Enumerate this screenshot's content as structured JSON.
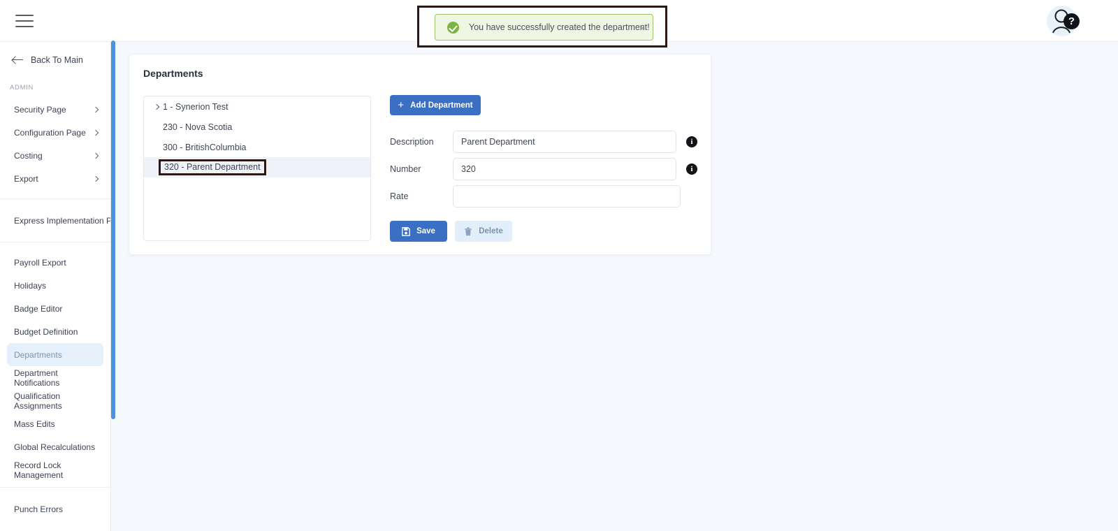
{
  "topbar": {
    "menu_icon": "hamburger-icon",
    "avatar_icon": "user-avatar-icon",
    "help_badge": "?"
  },
  "toast": {
    "message": "You have successfully created the department!",
    "status_icon": "success-check-icon",
    "close_label": "×",
    "bg_color": "#f0f6e4",
    "border_color": "#9cc46a",
    "icon_color": "#7cb342"
  },
  "sidebar": {
    "back_label": "Back To Main",
    "section_label": "ADMIN",
    "expandable": [
      {
        "label": "Security Page"
      },
      {
        "label": "Configuration Page"
      },
      {
        "label": "Costing"
      },
      {
        "label": "Export"
      }
    ],
    "standalone": [
      {
        "label": "Express Implementation P..."
      }
    ],
    "items": [
      {
        "label": "Payroll Export",
        "active": false
      },
      {
        "label": "Holidays",
        "active": false
      },
      {
        "label": "Badge Editor",
        "active": false
      },
      {
        "label": "Budget Definition",
        "active": false
      },
      {
        "label": "Departments",
        "active": true
      },
      {
        "label": "Department Notifications",
        "active": false
      },
      {
        "label": "Qualification Assignments",
        "active": false
      },
      {
        "label": "Mass Edits",
        "active": false
      },
      {
        "label": "Global Recalculations",
        "active": false
      },
      {
        "label": "Record Lock Management",
        "active": false
      }
    ],
    "footer_items": [
      {
        "label": "Punch Errors"
      }
    ],
    "active_color": "#e5f0fb",
    "scrollbar_color": "#4d93dd"
  },
  "card": {
    "title": "Departments",
    "tree": [
      {
        "label": "1 - Synerion Test",
        "expandable": true,
        "selected": false
      },
      {
        "label": "230 - Nova Scotia",
        "expandable": false,
        "selected": false
      },
      {
        "label": "300 - BritishColumbia",
        "expandable": false,
        "selected": false
      },
      {
        "label": "320 - Parent Department",
        "expandable": false,
        "selected": true
      }
    ],
    "add_button": {
      "label": "Add Department",
      "plus": "+",
      "color": "#3b6fc4"
    },
    "fields": [
      {
        "label": "Description",
        "value": "Parent Department",
        "info": true
      },
      {
        "label": "Number",
        "value": "320",
        "info": true
      },
      {
        "label": "Rate",
        "value": "",
        "info": false
      }
    ],
    "actions": {
      "save_label": "Save",
      "save_icon": "save-disk-icon",
      "delete_label": "Delete",
      "delete_icon": "trash-icon"
    }
  }
}
